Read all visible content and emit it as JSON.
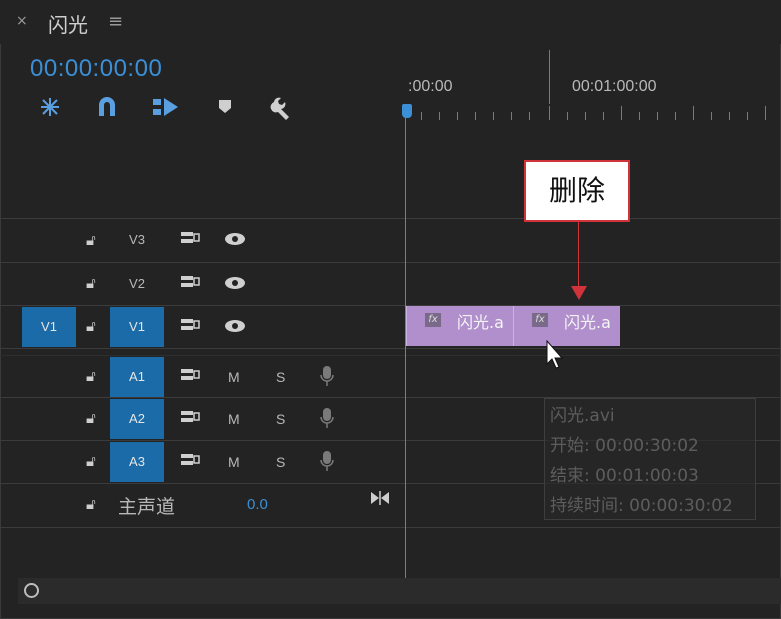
{
  "tab": {
    "close": "×",
    "title": "闪光",
    "menu": "≡"
  },
  "timecode": "00:00:00:00",
  "ruler": {
    "label0": ":00:00",
    "label1": "00:01:00:00"
  },
  "tracks": {
    "v3": {
      "name": "V3"
    },
    "v2": {
      "name": "V2"
    },
    "v1": {
      "source": "V1",
      "name": "V1"
    },
    "a1": {
      "name": "A1",
      "m": "M",
      "s": "S"
    },
    "a2": {
      "name": "A2",
      "m": "M",
      "s": "S"
    },
    "a3": {
      "name": "A3",
      "m": "M",
      "s": "S"
    }
  },
  "master": {
    "label": "主声道",
    "value": "0.0"
  },
  "clips": [
    {
      "fx": "fx",
      "name": "闪光.a"
    },
    {
      "fx": "fx",
      "name": "闪光.a"
    }
  ],
  "callout": {
    "text": "删除"
  },
  "tooltip": {
    "name": "闪光.avi",
    "start": "开始: 00:00:30:02",
    "end": "结束: 00:01:00:03",
    "duration": "持续时间: 00:00:30:02"
  },
  "colors": {
    "accent": "#3b8fd6",
    "clip": "#b18fcd",
    "callout_border": "#d0333a",
    "selected_track": "#1a6ba8"
  }
}
